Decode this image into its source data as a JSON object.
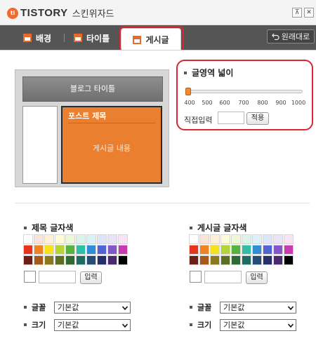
{
  "app": {
    "brand": "TISTORY",
    "logo_mark": "ti",
    "wizard_title": "스킨위자드",
    "restore_label": "원래대로"
  },
  "window_controls": {
    "pin_icon": "pin-icon",
    "close_icon": "close-icon"
  },
  "tabs": [
    {
      "label": "배경",
      "icon": "background-icon"
    },
    {
      "label": "타이틀",
      "icon": "title-icon"
    },
    {
      "label": "게시글",
      "icon": "post-icon",
      "active": true
    }
  ],
  "preview": {
    "blog_title": "블로그 타이틀",
    "post_title": "포스트 제목",
    "post_body": "게시글 내용"
  },
  "content_width": {
    "title": "글영역 넓이",
    "ticks": [
      "400",
      "500",
      "600",
      "700",
      "800",
      "900",
      "1000"
    ],
    "min": 400,
    "max": 1000,
    "value": 400,
    "direct_label": "직접입력",
    "direct_value": "",
    "apply_label": "적용"
  },
  "title_color": {
    "title": "제목 글자색",
    "hex_value": "",
    "input_label": "입력",
    "font_label": "글꼴",
    "font_value": "기본값",
    "size_label": "크기",
    "size_value": "기본값"
  },
  "post_color": {
    "title": "게시글 글자색",
    "hex_value": "",
    "input_label": "입력",
    "font_label": "글꼴",
    "font_value": "기본값",
    "size_label": "크기",
    "size_value": "기본값"
  },
  "palette_colors": [
    [
      "#ffffff",
      "#fbe3d9",
      "#fdf0d5",
      "#fefbd8",
      "#eef7d6",
      "#dcf3ec",
      "#dcf1f6",
      "#dee5f8",
      "#e8e3f6",
      "#f7e3f1"
    ],
    [
      "#e6351b",
      "#f08224",
      "#f7e11b",
      "#b5d534",
      "#56b33d",
      "#2fbfa5",
      "#2f8fd6",
      "#5263d8",
      "#8356c9",
      "#c93ab0"
    ],
    [
      "#6e1e19",
      "#a55a1c",
      "#8b7a1b",
      "#5a6f22",
      "#2f6a34",
      "#1f6b63",
      "#264b74",
      "#272f6a",
      "#4a2a6e",
      "#000000"
    ]
  ],
  "colors": {
    "accent": "#e97f2f",
    "highlight": "#d9262f",
    "tabstrip": "#555555"
  }
}
